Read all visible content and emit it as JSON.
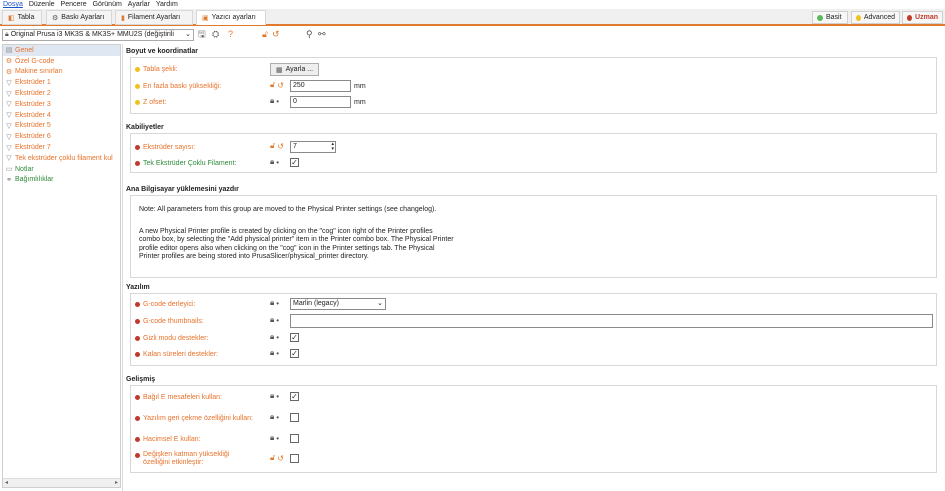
{
  "menu": [
    "Dosya",
    "Düzenle",
    "Pencere",
    "Görünüm",
    "Ayarlar",
    "Yardım"
  ],
  "tabs": [
    {
      "label": "Tabla",
      "icon": "plater-icon"
    },
    {
      "label": "Baskı Ayarları",
      "icon": "gear-icon"
    },
    {
      "label": "Filament Ayarları",
      "icon": "filament-icon"
    },
    {
      "label": "Yazıcı ayarları",
      "icon": "printer-icon"
    }
  ],
  "modes": [
    {
      "label": "Basit",
      "color": "#5cb85c"
    },
    {
      "label": "Advanced",
      "color": "#f0c020"
    },
    {
      "label": "Uzman",
      "color": "#c0392b"
    }
  ],
  "preset": {
    "value": "Original Prusa i3 MK3S & MK3S+ MMU2S (değiştirili"
  },
  "tree": [
    {
      "label": "Genel",
      "icon": "general-icon"
    },
    {
      "label": "Özel G-code",
      "icon": "cog-icon"
    },
    {
      "label": "Makine sınırları",
      "icon": "cog-icon"
    },
    {
      "label": "Ekstrüder 1",
      "icon": "extruder-icon"
    },
    {
      "label": "Ekstrüder 2",
      "icon": "extruder-icon"
    },
    {
      "label": "Ekstrüder 3",
      "icon": "extruder-icon"
    },
    {
      "label": "Ekstrüder 4",
      "icon": "extruder-icon"
    },
    {
      "label": "Ekstrüder 5",
      "icon": "extruder-icon"
    },
    {
      "label": "Ekstrüder 6",
      "icon": "extruder-icon"
    },
    {
      "label": "Ekstrüder 7",
      "icon": "extruder-icon"
    },
    {
      "label": "Tek ekstrüder çoklu filament kul",
      "icon": "extruder-icon"
    },
    {
      "label": "Notlar",
      "icon": "notes-icon"
    },
    {
      "label": "Bağımlılıklar",
      "icon": "dependencies-icon"
    }
  ],
  "groups": {
    "size": {
      "title": "Boyut ve koordinatlar",
      "bed_shape": {
        "label": "Tabla şekli:",
        "button": "Ayarla ..."
      },
      "max_height": {
        "label": "En fazla baskı yüksekliği:",
        "value": "250",
        "unit": "mm"
      },
      "z_offset": {
        "label": "Z ofset:",
        "value": "0",
        "unit": "mm"
      }
    },
    "capabilities": {
      "title": "Kabiliyetler",
      "extruders": {
        "label": "Ekstrüder sayısı:",
        "value": "7"
      },
      "single_extruder_mm": {
        "label": "Tek Ekstrüder Çoklu Filament:",
        "checked": true
      }
    },
    "host": {
      "title": "Ana Bilgisayar yüklemesini yazdır",
      "note1": "Note: All parameters from this group are moved to the Physical Printer settings (see changelog).",
      "note2_lines": [
        "A new Physical Printer profile is created by clicking on the \"cog\" icon right of the Printer profiles",
        "combo box, by selecting the \"Add physical printer\" item in the Printer combo box. The Physical Printer",
        "profile editor opens also when clicking on the \"cog\" icon in the Printer settings tab. The Physical",
        "Printer profiles are being stored into PrusaSlicer/physical_printer directory."
      ]
    },
    "firmware": {
      "title": "Yazılım",
      "gcode_flavor": {
        "label": "G-code derleyici:",
        "value": "Marlin (legacy)"
      },
      "thumbnails": {
        "label": "G-code thumbnails:",
        "value": ""
      },
      "silent_mode": {
        "label": "Gizli modu destekler:",
        "checked": true
      },
      "remaining_times": {
        "label": "Kalan süreleri destekler:",
        "checked": true
      }
    },
    "advanced": {
      "title": "Gelişmiş",
      "relative_e": {
        "label": "Bağıl E mesafeleri kullan:",
        "checked": true
      },
      "fw_retract": {
        "label": "Yazılım geri çekme özelliğini kullan:",
        "checked": false
      },
      "volumetric_e": {
        "label": "Hacimsel E kullan:",
        "checked": false
      },
      "variable_layer_line1": "Değişken katman yüksekliği",
      "variable_layer_line2": "özelliğini etkinleştir:",
      "variable_layer_checked": false
    }
  },
  "colors": {
    "accent": "#e07a2e",
    "expert": "#c0392b",
    "advanced": "#f0c020",
    "simple": "#5cb85c"
  }
}
